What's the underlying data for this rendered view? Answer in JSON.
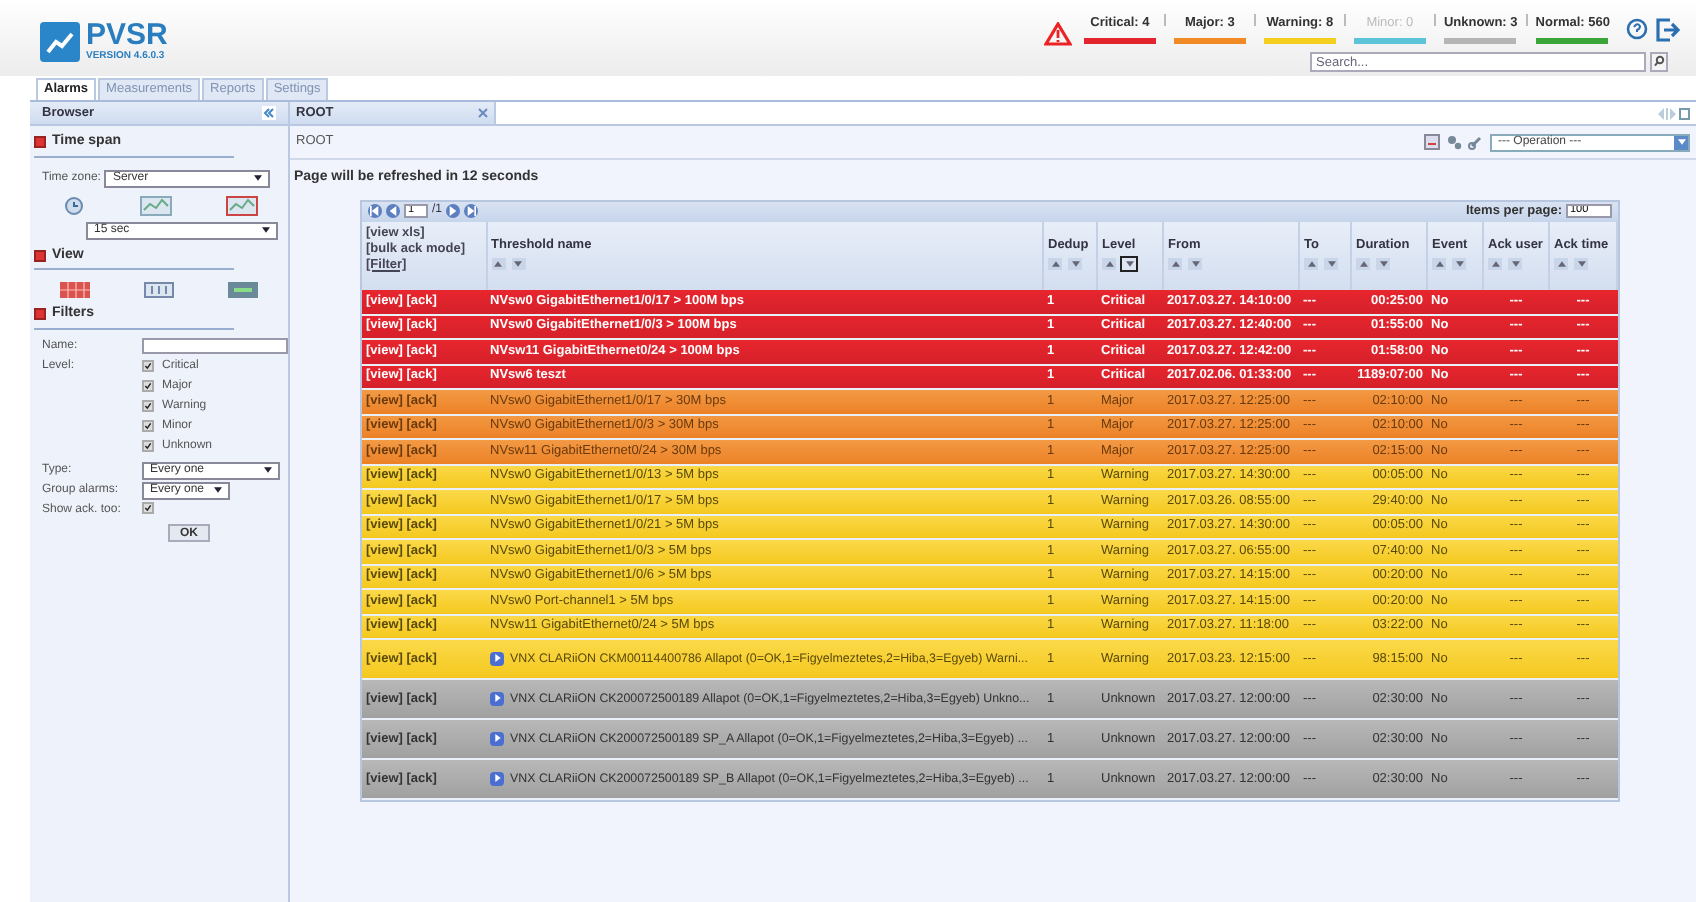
{
  "app": {
    "name": "PVSR",
    "version": "VERSION 4.6.0.3"
  },
  "status_counts": [
    {
      "label": "Critical: 4",
      "color": "#e3262d",
      "disabled": false
    },
    {
      "label": "Major: 3",
      "color": "#f08a24",
      "disabled": false
    },
    {
      "label": "Warning: 8",
      "color": "#f5cf1f",
      "disabled": false
    },
    {
      "label": "Minor: 0",
      "color": "#5bc4d6",
      "disabled": true
    },
    {
      "label": "Unknown: 3",
      "color": "#b5b5b5",
      "disabled": false
    },
    {
      "label": "Normal: 560",
      "color": "#3aa63a",
      "disabled": false
    }
  ],
  "search": {
    "placeholder": "Search..."
  },
  "tabs": [
    {
      "label": "Alarms",
      "selected": true
    },
    {
      "label": "Measurements",
      "selected": false
    },
    {
      "label": "Reports",
      "selected": false
    },
    {
      "label": "Settings",
      "selected": false
    }
  ],
  "sidebar": {
    "title": "Browser",
    "time_span": {
      "title": "Time span",
      "time_zone_label": "Time zone:",
      "time_zone": "Server",
      "interval": "15 sec"
    },
    "view": {
      "title": "View"
    },
    "filters": {
      "title": "Filters",
      "name_label": "Name:",
      "level_label": "Level:",
      "levels": [
        {
          "label": "Critical",
          "checked": true
        },
        {
          "label": "Major",
          "checked": true
        },
        {
          "label": "Warning",
          "checked": true
        },
        {
          "label": "Minor",
          "checked": true
        },
        {
          "label": "Unknown",
          "checked": true
        }
      ],
      "type_label": "Type:",
      "type": "Every one",
      "group_label": "Group alarms:",
      "group": "Every one",
      "show_ack_label": "Show ack. too:",
      "show_ack": true,
      "ok": "OK"
    }
  },
  "main": {
    "tab": "ROOT",
    "breadcrumb": "ROOT",
    "operation": "--- Operation ---",
    "refresh_note": "Page will be refreshed in 12 seconds",
    "pager": {
      "page": "1",
      "total": "/1",
      "items_label": "Items per page:",
      "items": "100"
    },
    "columns": [
      {
        "links": [
          "[view xls]",
          "[bulk ack mode]",
          "[Filter]"
        ]
      },
      {
        "label": "Threshold name",
        "sorted": false
      },
      {
        "label": "Dedup",
        "sorted": false
      },
      {
        "label": "Level",
        "sorted": true
      },
      {
        "label": "From",
        "sorted": false
      },
      {
        "label": "To",
        "sorted": false
      },
      {
        "label": "Duration",
        "sorted": false
      },
      {
        "label": "Event",
        "sorted": false
      },
      {
        "label": "Ack user",
        "sorted": false
      },
      {
        "label": "Ack time",
        "sorted": false
      }
    ],
    "rows": [
      {
        "kind": "critical",
        "expandable": false,
        "cells": [
          "[view] [ack]",
          "NVsw0 GigabitEthernet1/0/17 > 100M bps",
          "1",
          "Critical",
          "2017.03.27. 14:10:00",
          "---",
          "00:25:00",
          "No",
          "---",
          "---"
        ]
      },
      {
        "kind": "critical",
        "expandable": false,
        "cells": [
          "[view] [ack]",
          "NVsw0 GigabitEthernet1/0/3 > 100M bps",
          "1",
          "Critical",
          "2017.03.27. 12:40:00",
          "---",
          "01:55:00",
          "No",
          "---",
          "---"
        ]
      },
      {
        "kind": "critical",
        "expandable": false,
        "cells": [
          "[view] [ack]",
          "NVsw11 GigabitEthernet0/24 > 100M bps",
          "1",
          "Critical",
          "2017.03.27. 12:42:00",
          "---",
          "01:58:00",
          "No",
          "---",
          "---"
        ]
      },
      {
        "kind": "critical",
        "expandable": false,
        "cells": [
          "[view] [ack]",
          "NVsw6 teszt",
          "1",
          "Critical",
          "2017.02.06. 01:33:00",
          "---",
          "1189:07:00",
          "No",
          "---",
          "---"
        ]
      },
      {
        "kind": "major",
        "expandable": false,
        "cells": [
          "[view] [ack]",
          "NVsw0 GigabitEthernet1/0/17 > 30M bps",
          "1",
          "Major",
          "2017.03.27. 12:25:00",
          "---",
          "02:10:00",
          "No",
          "---",
          "---"
        ]
      },
      {
        "kind": "major",
        "expandable": false,
        "cells": [
          "[view] [ack]",
          "NVsw0 GigabitEthernet1/0/3 > 30M bps",
          "1",
          "Major",
          "2017.03.27. 12:25:00",
          "---",
          "02:10:00",
          "No",
          "---",
          "---"
        ]
      },
      {
        "kind": "major",
        "expandable": false,
        "cells": [
          "[view] [ack]",
          "NVsw11 GigabitEthernet0/24 > 30M bps",
          "1",
          "Major",
          "2017.03.27. 12:25:00",
          "---",
          "02:15:00",
          "No",
          "---",
          "---"
        ]
      },
      {
        "kind": "warning",
        "expandable": false,
        "cells": [
          "[view] [ack]",
          "NVsw0 GigabitEthernet1/0/13 > 5M bps",
          "1",
          "Warning",
          "2017.03.27. 14:30:00",
          "---",
          "00:05:00",
          "No",
          "---",
          "---"
        ]
      },
      {
        "kind": "warning",
        "expandable": false,
        "cells": [
          "[view] [ack]",
          "NVsw0 GigabitEthernet1/0/17 > 5M bps",
          "1",
          "Warning",
          "2017.03.26. 08:55:00",
          "---",
          "29:40:00",
          "No",
          "---",
          "---"
        ]
      },
      {
        "kind": "warning",
        "expandable": false,
        "cells": [
          "[view] [ack]",
          "NVsw0 GigabitEthernet1/0/21 > 5M bps",
          "1",
          "Warning",
          "2017.03.27. 14:30:00",
          "---",
          "00:05:00",
          "No",
          "---",
          "---"
        ]
      },
      {
        "kind": "warning",
        "expandable": false,
        "cells": [
          "[view] [ack]",
          "NVsw0 GigabitEthernet1/0/3 > 5M bps",
          "1",
          "Warning",
          "2017.03.27. 06:55:00",
          "---",
          "07:40:00",
          "No",
          "---",
          "---"
        ]
      },
      {
        "kind": "warning",
        "expandable": false,
        "cells": [
          "[view] [ack]",
          "NVsw0 GigabitEthernet1/0/6 > 5M bps",
          "1",
          "Warning",
          "2017.03.27. 14:15:00",
          "---",
          "00:20:00",
          "No",
          "---",
          "---"
        ]
      },
      {
        "kind": "warning",
        "expandable": false,
        "cells": [
          "[view] [ack]",
          "NVsw0 Port-channel1 > 5M bps",
          "1",
          "Warning",
          "2017.03.27. 14:15:00",
          "---",
          "00:20:00",
          "No",
          "---",
          "---"
        ]
      },
      {
        "kind": "warning",
        "expandable": false,
        "cells": [
          "[view] [ack]",
          "NVsw11 GigabitEthernet0/24 > 5M bps",
          "1",
          "Warning",
          "2017.03.27. 11:18:00",
          "---",
          "03:22:00",
          "No",
          "---",
          "---"
        ]
      },
      {
        "kind": "warning",
        "expandable": true,
        "cells": [
          "[view] [ack]",
          "VNX CLARiiON CKM00114400786 Allapot (0=OK,1=Figyelmeztetes,2=Hiba,3=Egyeb) Warni...",
          "1",
          "Warning",
          "2017.03.23. 12:15:00",
          "---",
          "98:15:00",
          "No",
          "---",
          "---"
        ]
      },
      {
        "kind": "unknown",
        "expandable": true,
        "cells": [
          "[view] [ack]",
          "VNX CLARiiON CK200072500189 Allapot (0=OK,1=Figyelmeztetes,2=Hiba,3=Egyeb) Unkno...",
          "1",
          "Unknown",
          "2017.03.27. 12:00:00",
          "---",
          "02:30:00",
          "No",
          "---",
          "---"
        ]
      },
      {
        "kind": "unknown",
        "expandable": true,
        "cells": [
          "[view] [ack]",
          "VNX CLARiiON CK200072500189 SP_A Allapot (0=OK,1=Figyelmeztetes,2=Hiba,3=Egyeb) ...",
          "1",
          "Unknown",
          "2017.03.27. 12:00:00",
          "---",
          "02:30:00",
          "No",
          "---",
          "---"
        ]
      },
      {
        "kind": "unknown",
        "expandable": true,
        "cells": [
          "[view] [ack]",
          "VNX CLARiiON CK200072500189 SP_B Allapot (0=OK,1=Figyelmeztetes,2=Hiba,3=Egyeb) ...",
          "1",
          "Unknown",
          "2017.03.27. 12:00:00",
          "---",
          "02:30:00",
          "No",
          "---",
          "---"
        ]
      }
    ]
  }
}
